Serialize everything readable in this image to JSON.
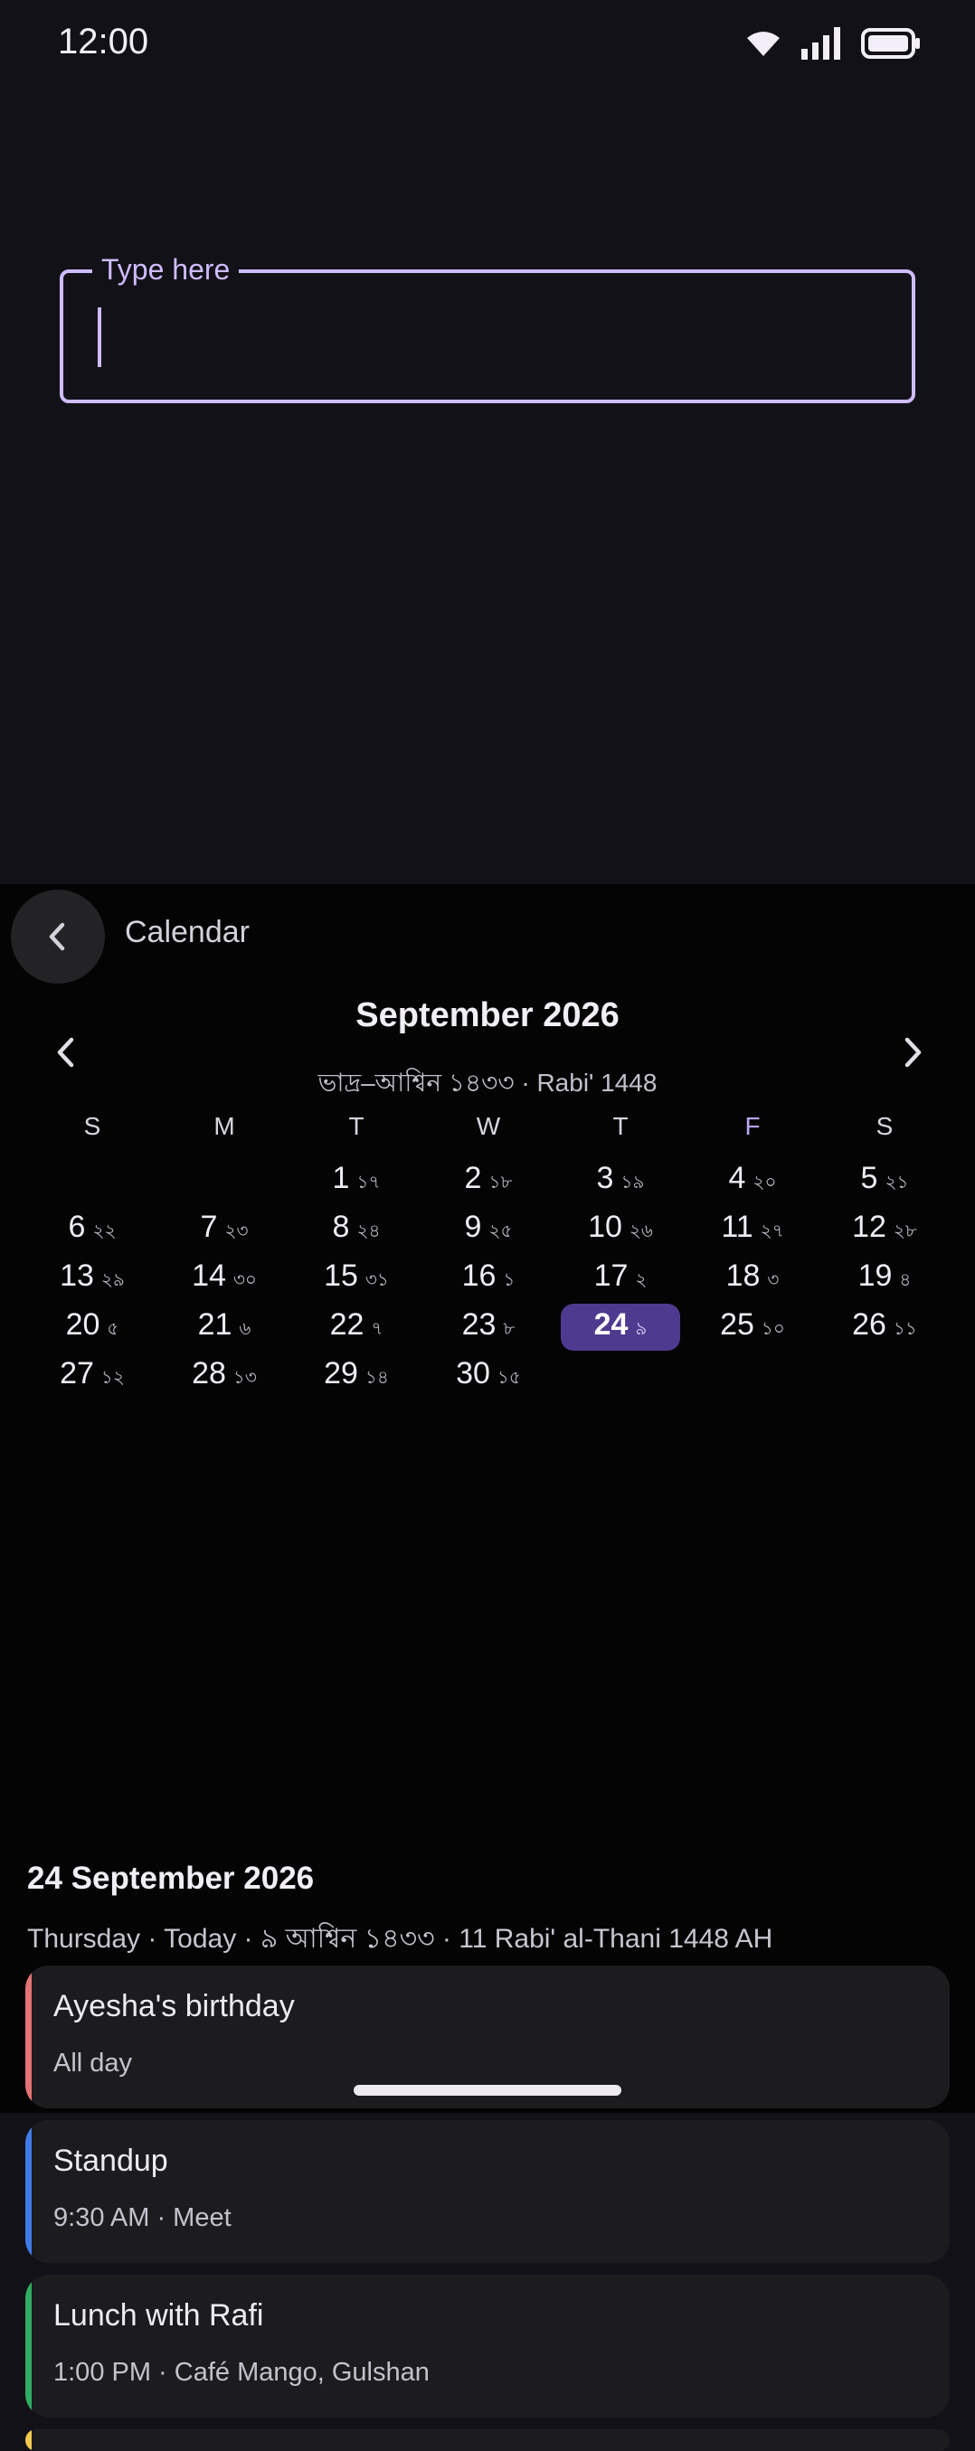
{
  "status": {
    "time": "12:00"
  },
  "input": {
    "label": "Type here",
    "value": ""
  },
  "calendar": {
    "panel_title": "Calendar",
    "month_title": "September 2026",
    "month_subtitle": "ভাদ্র–আশ্বিন ১৪৩৩  ·  Rabi' 1448",
    "weekdays": [
      "S",
      "M",
      "T",
      "W",
      "T",
      "F",
      "S"
    ],
    "days": [
      {
        "d": "1",
        "b": "১৭"
      },
      {
        "d": "2",
        "b": "১৮"
      },
      {
        "d": "3",
        "b": "১৯"
      },
      {
        "d": "4",
        "b": "২০"
      },
      {
        "d": "5",
        "b": "২১"
      },
      {
        "d": "6",
        "b": "২২"
      },
      {
        "d": "7",
        "b": "২৩"
      },
      {
        "d": "8",
        "b": "২৪"
      },
      {
        "d": "9",
        "b": "২৫"
      },
      {
        "d": "10",
        "b": "২৬"
      },
      {
        "d": "11",
        "b": "২৭"
      },
      {
        "d": "12",
        "b": "২৮"
      },
      {
        "d": "13",
        "b": "২৯"
      },
      {
        "d": "14",
        "b": "৩০"
      },
      {
        "d": "15",
        "b": "৩১"
      },
      {
        "d": "16",
        "b": "১"
      },
      {
        "d": "17",
        "b": "২"
      },
      {
        "d": "18",
        "b": "৩"
      },
      {
        "d": "19",
        "b": "৪"
      },
      {
        "d": "20",
        "b": "৫"
      },
      {
        "d": "21",
        "b": "৬"
      },
      {
        "d": "22",
        "b": "৭"
      },
      {
        "d": "23",
        "b": "৮"
      },
      {
        "d": "24",
        "b": "৯"
      },
      {
        "d": "25",
        "b": "১০"
      },
      {
        "d": "26",
        "b": "১১"
      },
      {
        "d": "27",
        "b": "১২"
      },
      {
        "d": "28",
        "b": "১৩"
      },
      {
        "d": "29",
        "b": "১৪"
      },
      {
        "d": "30",
        "b": "১৫"
      }
    ],
    "first_weekday": 2,
    "today": "24",
    "selected_date": "24 September 2026",
    "selected_subtitle": "Thursday · Today · ৯ আশ্বিন ১৪৩৩ · 11 Rabi' al-Thani 1448 AH"
  },
  "events": [
    {
      "title": "Ayesha's birthday",
      "meta": "All day",
      "color": "#E57373"
    },
    {
      "title": "Standup",
      "meta": "9:30 AM · Meet",
      "color": "#3F7BE8"
    },
    {
      "title": "Lunch with Rafi",
      "meta": "1:00 PM · Café Mango, Gulshan",
      "color": "#2FAE63"
    },
    {
      "title": "",
      "meta": "",
      "color": "#F2C94C"
    }
  ],
  "colors": {
    "accent": "#CFBCFF",
    "today_bg": "#4E3A8E",
    "background": "#131118",
    "panel": "#040405"
  }
}
